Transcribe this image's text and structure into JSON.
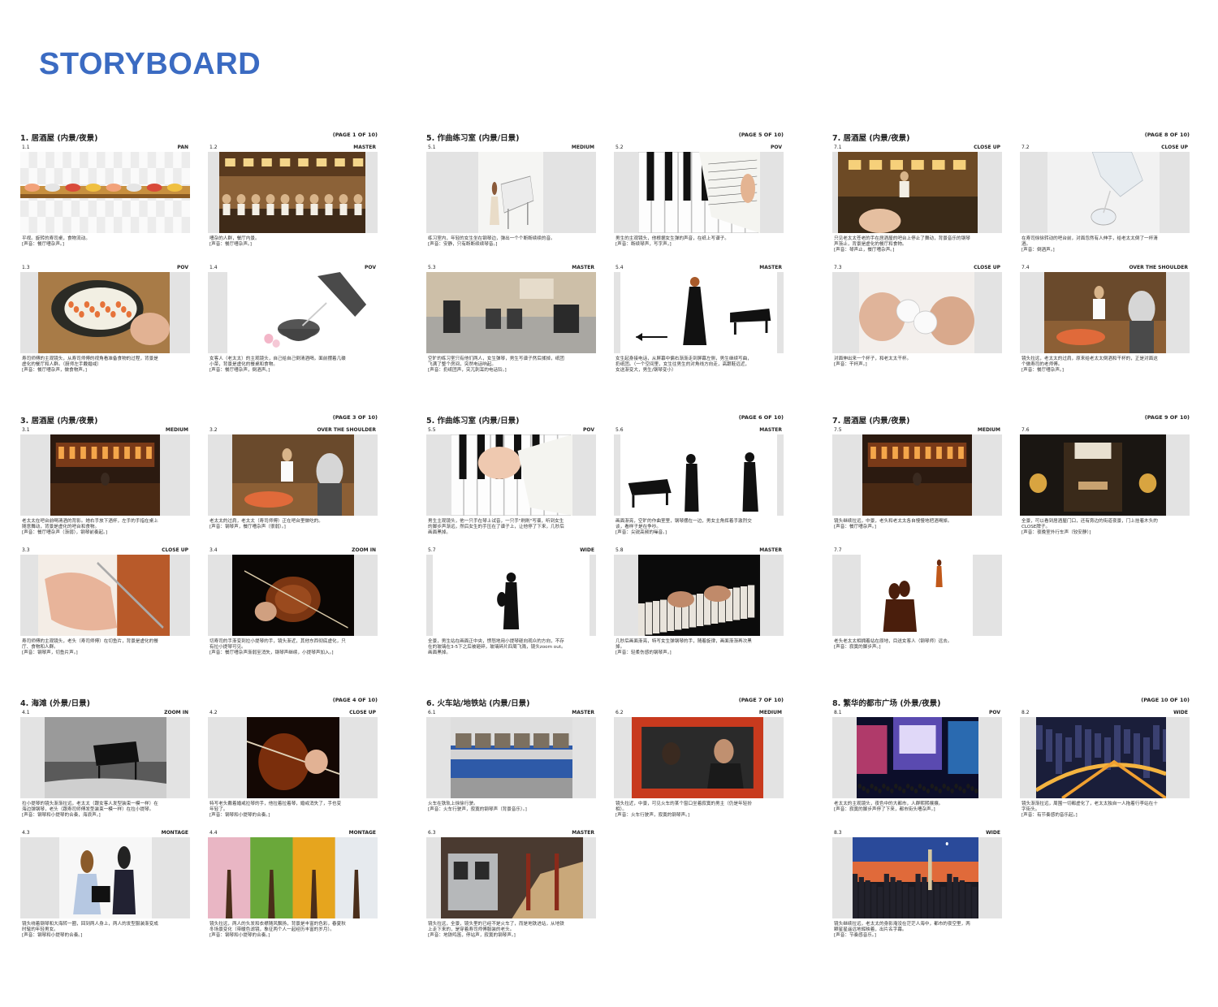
{
  "title": "STORYBOARD",
  "pages": [
    {
      "scene": "1. 居酒屋 (内景/夜景)",
      "page_label": "(PAGE 1 OF 10)",
      "panels": [
        {
          "num": "1.1",
          "shot": "PAN",
          "image": "sushi-conveyor",
          "desc": [
            "平视。旋转的寿司桌，食物流动。",
            "[声音：餐厅嘈杂声。]"
          ]
        },
        {
          "num": "1.2",
          "shot": "MASTER",
          "image": "busy-restaurant",
          "desc": [
            "嘈杂的人群，餐厅内景。",
            "[声音：餐厅嘈杂声。]"
          ]
        },
        {
          "num": "1.3",
          "shot": "POV",
          "image": "sushi-roll-making",
          "desc": [
            "寿司师傅的主观镜头，从寿司师傅的视角看准备食物的过程，背景是",
            "虚化的餐厅和人群。（厨师左手戴婚戒）",
            "[声音：餐厅嘈杂声，做食物声。]"
          ]
        },
        {
          "num": "1.4",
          "shot": "POV",
          "image": "sake-pouring",
          "desc": [
            "女客人（老太太）的主观镜头，自己给自己倒清酒喝，面前摆着几碟",
            "小菜，背景是虚化的餐桌和食物。",
            "[声音：餐厅嘈杂声，倒酒声。]"
          ]
        }
      ]
    },
    {
      "scene": "5. 作曲练习室 (内景/日景)",
      "page_label": "(PAGE 5 OF 10)",
      "panels": [
        {
          "num": "5.1",
          "shot": "MEDIUM",
          "image": "girl-at-piano-sketch",
          "desc": [
            "练习室内，年轻的女生坐在钢琴边，弹出一个个断断续续的音。",
            "[声音：安静，只有断断续续琴音。]"
          ]
        },
        {
          "num": "5.2",
          "shot": "POV",
          "image": "piano-keys-score",
          "desc": [
            "男生的主观镜头，他根据女生弹的声音，在纸上写谱子。",
            "[声音：断续琴声，写字声。]"
          ]
        },
        {
          "num": "5.3",
          "shot": "MASTER",
          "image": "empty-practice-room",
          "desc": [
            "空旷的练习室只有他们两人，女生弹琴，男生写谱子然后揉掉，纸团",
            "飞满了整个房间，突然电话响起。",
            "[声音：扔纸团声，突兀刺耳的电话铃。]"
          ]
        },
        {
          "num": "5.4",
          "shot": "MASTER",
          "image": "woman-walking-phone",
          "desc": [
            "女生起身接电话，从屏幕中偏右渐渐走到屏幕左侧，男生继续写曲，",
            "扔纸团。（一个空间里，女生往男生的对角线方向走，高跟鞋远近，",
            "女送渐变大，男生/钢琴变小）"
          ]
        }
      ]
    },
    {
      "scene": "7. 居酒屋 (内景/夜景)",
      "page_label": "(PAGE 8 OF 10)",
      "panels": [
        {
          "num": "7.1",
          "shot": "CLOSE UP",
          "image": "hand-at-sushi-bar",
          "desc": [
            "只见老太太苍老的手在居酒屋的吧台上停止了舞动，背景音乐的钢琴",
            "声渐止，背景是虚化的餐厅和食物。",
            "[声音：琴声止，餐厅嘈杂声。]"
          ]
        },
        {
          "num": "7.2",
          "shot": "CLOSE UP",
          "image": "sake-bottle-pour",
          "desc": [
            "在寿司徐徐转动的吧台前，对面忽然有人伸手，给老太太倒了一杯清",
            "酒。",
            "[声音：倒酒声。]"
          ]
        },
        {
          "num": "7.3",
          "shot": "CLOSE UP",
          "image": "sake-cups-toast",
          "desc": [
            "对面伸出来一个杯子，和老太太干杯。",
            "[声音：干杯声。]"
          ]
        },
        {
          "num": "7.4",
          "shot": "OVER THE SHOULDER",
          "image": "sushi-chef-counter",
          "desc": [
            "镜头拉远，老太太的过肩，原来给老太太倒酒和干杯的，正是对面这",
            "个做寿司的老师傅。",
            "[声音：餐厅嘈杂声。]"
          ]
        }
      ]
    },
    {
      "scene": "3. 居酒屋 (内景/夜景)",
      "page_label": "(PAGE 3 OF 10)",
      "panels": [
        {
          "num": "3.1",
          "shot": "MEDIUM",
          "image": "izakaya-bar-night",
          "desc": [
            "老太太在吧台前喝清酒的背影。她右手放下酒杯，左手的手指在桌上",
            "随意舞动，背景是虚化的吧台和食物。",
            "[声音：餐厅嘈杂声（渐弱），钢琴前奏起。]"
          ]
        },
        {
          "num": "3.2",
          "shot": "OVER THE SHOULDER",
          "image": "sushi-chef-counter",
          "desc": [
            "老太太的过肩，老太太（寿司师傅）正在吧台里做吃的。",
            "[声音：钢琴声，餐厅嘈杂声（很弱）。]"
          ]
        },
        {
          "num": "3.3",
          "shot": "CLOSE UP",
          "image": "hand-cutting-fish",
          "desc": [
            "寿司师傅的主观镜头，老头（寿司师傅）在切鱼片，背景是虚化的餐",
            "厅、食物和人群。",
            "[声音：钢琴声，切鱼片声。]"
          ]
        },
        {
          "num": "3.4",
          "shot": "ZOOM IN",
          "image": "violin-playing",
          "desc": [
            "切寿司的手渐变到拉小提琴的手，镜头渐近，其他东西彻底虚化，只",
            "有拉小提琴可见。",
            "[声音：餐厅嘈杂声渐弱至消失，钢琴声继续，小提琴声加入。]"
          ]
        }
      ]
    },
    {
      "scene": "5. 作曲练习室 (内景/日景)",
      "page_label": "(PAGE 6 OF 10)",
      "panels": [
        {
          "num": "5.5",
          "shot": "POV",
          "image": "hand-on-piano-score",
          "desc": [
            "男生主观镜头，他一只手在琴上试音，一只手\"刷刷\"写谱，听到女生",
            "的脚步声渐远，然后女生的手压在了谱子上，让他停了下来，几秒后",
            "画面黑掉。"
          ]
        },
        {
          "num": "5.6",
          "shot": "MASTER",
          "image": "silhouettes-piano-violin",
          "desc": [
            "画面渐亮，空旷的作曲室里，钢琴摆在一边，男女主角挥着手激烈交",
            "谈，看样子是在争吵。",
            "[声音：尖锐高频的噪音。]"
          ]
        },
        {
          "num": "5.7",
          "shot": "WIDE",
          "image": "lone-violinist-silhouette",
          "desc": [
            "全景，男生站在画面正中央，愤怒地用小提琴砸向观众的方向，不存",
            "在的玻璃在3-5下之后被砸碎，玻璃碎片四周飞溅，镜头zoom out。",
            "画面黑掉。"
          ]
        },
        {
          "num": "5.8",
          "shot": "MASTER",
          "image": "hands-piano-dark",
          "desc": [
            "几秒后画面渐亮，特写女生弹钢琴的手，随着旋律，画面渐渐再次黑",
            "掉。",
            "[声音：轻柔伤感的钢琴声。]"
          ]
        }
      ]
    },
    {
      "scene": "7. 居酒屋 (内景/夜景)",
      "page_label": "(PAGE 9 OF 10)",
      "panels": [
        {
          "num": "7.5",
          "shot": "MEDIUM",
          "image": "izakaya-bar-night",
          "desc": [
            "镜头继续拉远，中景，老头和老太太各自慢慢地把酒喝掉。",
            "[声音：餐厅嘈杂声。]"
          ]
        },
        {
          "num": "7.6",
          "shot": "",
          "image": "izakaya-doorway-closed",
          "desc": [
            "全景，可以看到居酒屋门口，还有旁边的街道夜景，门上挂着木头的",
            "CLOSE牌子。",
            "[声音：夜晚室外行车声（较安静）]"
          ]
        },
        {
          "num": "7.7",
          "shot": "",
          "image": "couple-silhouette",
          "desc": [
            "老头老太太相拥着站在原地，目送女客人（钢琴师）远去。",
            "[声音：寂寞的脚步声。]"
          ]
        }
      ]
    },
    {
      "scene": "4. 海滩 (外景/日景)",
      "page_label": "(PAGE 4 OF 10)",
      "panels": [
        {
          "num": "4.1",
          "shot": "ZOOM IN",
          "image": "piano-on-beach",
          "desc": [
            "拉小提琴的镜头渐渐拉远，老太太（跟女客人发型装束一模一样）在",
            "海边弹钢琴，老头（跟寿司师傅发型装束一模一样）在拉小提琴。",
            "[声音：钢琴和小提琴的合奏，海浪声。]"
          ]
        },
        {
          "num": "4.2",
          "shot": "CLOSE UP",
          "image": "violin-closeup-ring",
          "desc": [
            "特写老头戴着婚戒拉琴的手，他拉着拉着琴，婚戒消失了，手也变",
            "年轻了。",
            "[声音：钢琴和小提琴的合奏。]"
          ]
        },
        {
          "num": "4.3",
          "shot": "MONTAGE",
          "image": "anime-couple-music",
          "desc": [
            "镜头绕着钢琴和大海转一圈，回到两人身上，两人的发型服装渐变成",
            "时髦的年轻男女。",
            "[声音：钢琴和小提琴的合奏。]"
          ]
        },
        {
          "num": "4.4",
          "shot": "MONTAGE",
          "image": "four-seasons-trees",
          "desc": [
            "镜头拉远，两人的头发和衣襟随风飘扬，背景是丰富的色彩，春夏秋",
            "冬场景变化（带暖色滤镜，象征两个人一起经历丰富的岁月）。",
            "[声音：钢琴和小提琴的合奏。]"
          ]
        }
      ]
    },
    {
      "scene": "6. 火车站/地铁站 (内景/日景)",
      "page_label": "(PAGE 7 OF 10)",
      "panels": [
        {
          "num": "6.1",
          "shot": "MASTER",
          "image": "blue-train",
          "desc": [
            "火车在铁轨上徐徐行驶。",
            "[声音：火车行驶声，寂寞的钢琴声（背景音乐）。]"
          ]
        },
        {
          "num": "6.2",
          "shot": "MEDIUM",
          "image": "man-train-window",
          "desc": [
            "镜头拉近，中景，可见火车的某个窗口坐着寂寞的男主（仍是年轻扮",
            "相）。",
            "[声音：火车行驶声，寂寞的钢琴声。]"
          ]
        },
        {
          "num": "6.3",
          "shot": "MASTER",
          "image": "subway-station",
          "desc": [
            "镜头拉远，全景，镜头里的已经不是火车了，而是地铁进站，从地铁",
            "上走下来的，是穿着寿司师傅服装的老头。",
            "[声音：地铁鸣笛，停站声，寂寞的钢琴声。]"
          ]
        }
      ]
    },
    {
      "scene": "8. 繁华的都市广场 (外景/夜景)",
      "page_label": "(PAGE 10 OF 10)",
      "panels": [
        {
          "num": "8.1",
          "shot": "POV",
          "image": "city-square-crowd",
          "desc": [
            "老太太的主观镜头，夜色中的大都市，人群熙熙攘攘。",
            "[声音：寂寞的脚步声停了下来，都市街头嘈杂声。]"
          ]
        },
        {
          "num": "8.2",
          "shot": "WIDE",
          "image": "city-highway-night",
          "desc": [
            "镜头渐渐拉远，周围一切都虚化了，老太太独自一人拖着行李站在十",
            "字街头。",
            "[声音：有节奏感的音乐起。]"
          ]
        },
        {
          "num": "8.3",
          "shot": "WIDE",
          "image": "city-skyline-dusk",
          "desc": [
            "镜头继续拉远，老太太的身影淹没在茫茫人海中，都市的夜空里，两",
            "颗星星遥远地辉映着，出片名字幕。",
            "[声音：节奏感音乐。]"
          ]
        }
      ]
    }
  ]
}
